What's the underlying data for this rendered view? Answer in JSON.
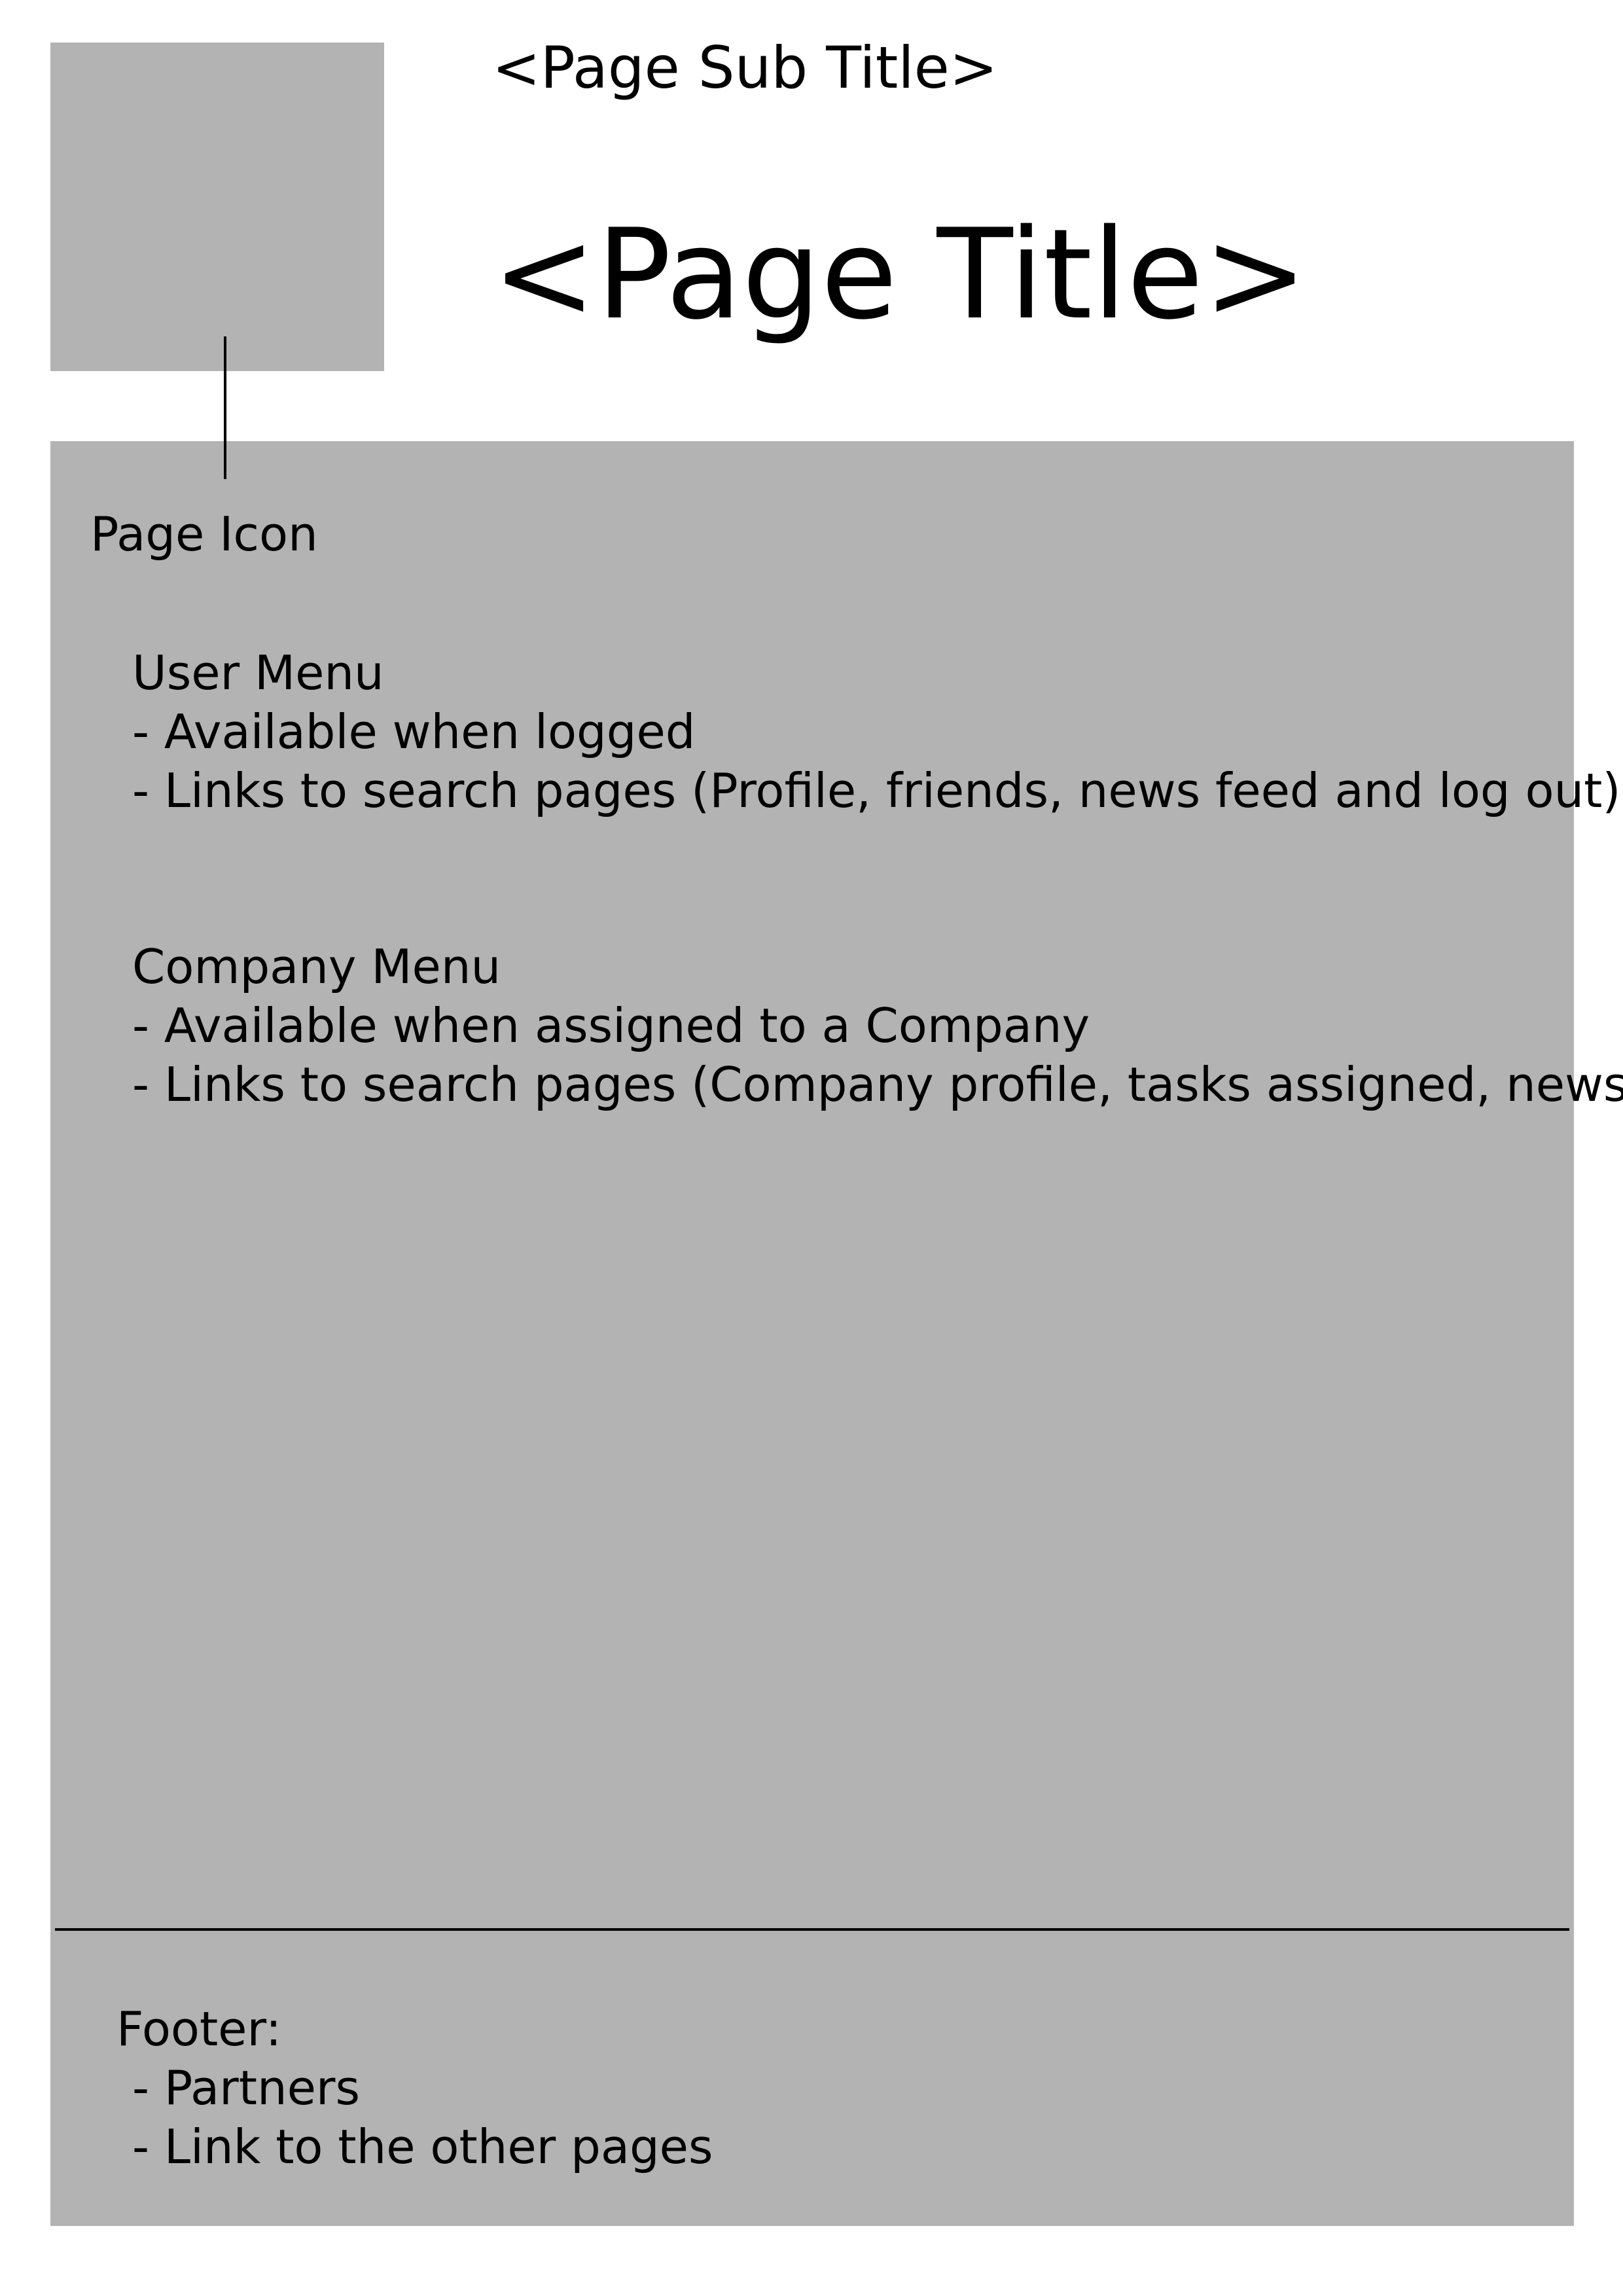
{
  "header": {
    "subtitle": "<Page Sub Title>",
    "title": "<Page Title>"
  },
  "page_icon": {
    "label": "Page Icon"
  },
  "user_menu": {
    "heading": "User Menu",
    "items": [
      "- Available when logged",
      "- Links to search pages (Profile, friends, news feed and log out)"
    ]
  },
  "company_menu": {
    "heading": "Company Menu",
    "items": [
      "- Available when assigned to a Company",
      "- Links to search pages (Company profile, tasks assigned, news)"
    ]
  },
  "footer": {
    "heading": "Footer:",
    "items": [
      "- Partners",
      "- Link to the other pages"
    ]
  },
  "colors": {
    "placeholder_gray": "#b3b3b3",
    "line": "#000000",
    "background": "#ffffff"
  }
}
